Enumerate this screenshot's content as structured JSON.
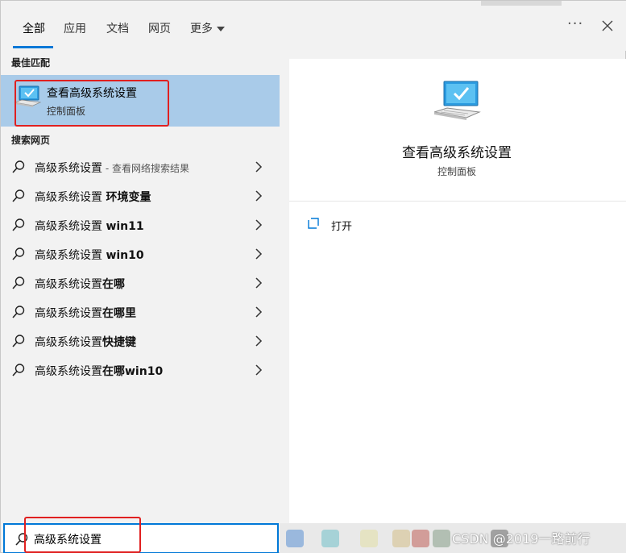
{
  "tabs": [
    {
      "label": "全部",
      "active": true
    },
    {
      "label": "应用"
    },
    {
      "label": "文档"
    },
    {
      "label": "网页"
    },
    {
      "label": "更多"
    }
  ],
  "window": {
    "more_icon": "ellipsis-icon",
    "close_icon": "close-icon"
  },
  "best_match": {
    "header": "最佳匹配",
    "title": "查看高级系统设置",
    "subtitle": "控制面板",
    "icon": "monitor-check-icon"
  },
  "web_search": {
    "header": "搜索网页",
    "items": [
      {
        "prefix": "高级系统设置",
        "bold": "",
        "hint": " - 查看网络搜索结果"
      },
      {
        "prefix": "高级系统设置 ",
        "bold": "环境变量",
        "hint": ""
      },
      {
        "prefix": "高级系统设置 ",
        "bold": "win11",
        "hint": ""
      },
      {
        "prefix": "高级系统设置 ",
        "bold": "win10",
        "hint": ""
      },
      {
        "prefix": "高级系统设置",
        "bold": "在哪",
        "hint": ""
      },
      {
        "prefix": "高级系统设置",
        "bold": "在哪里",
        "hint": ""
      },
      {
        "prefix": "高级系统设置",
        "bold": "快捷键",
        "hint": ""
      },
      {
        "prefix": "高级系统设置",
        "bold": "在哪win10",
        "hint": ""
      }
    ]
  },
  "details": {
    "title": "查看高级系统设置",
    "subtitle": "控制面板",
    "actions": [
      {
        "label": "打开",
        "icon": "open-icon"
      }
    ]
  },
  "search": {
    "value": "高级系统设置",
    "icon": "search-icon"
  },
  "watermark": "CSDN @2019一路前行",
  "colors": {
    "accent": "#0078d7",
    "selection": "#a9cbe9",
    "highlight_box": "#e02020"
  }
}
